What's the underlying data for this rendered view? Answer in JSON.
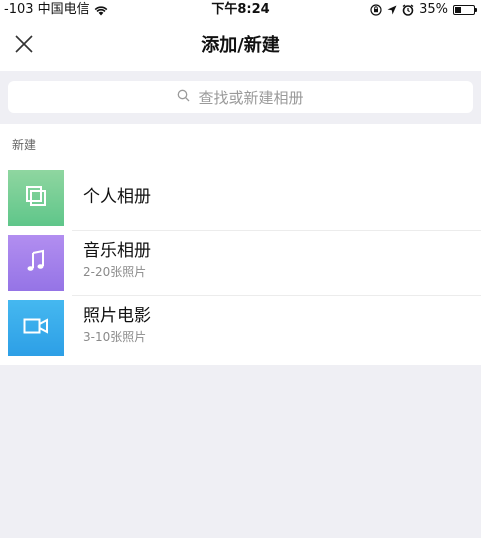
{
  "status_bar": {
    "carrier": "-103 中国电信",
    "time": "下午8:24",
    "battery": "35%",
    "battery_level": 0.35
  },
  "nav": {
    "title": "添加/新建"
  },
  "search": {
    "placeholder": "查找或新建相册"
  },
  "section": {
    "header": "新建"
  },
  "items": [
    {
      "title": "个人相册",
      "subtitle": "",
      "icon": "album-icon",
      "color": "#6fcd93"
    },
    {
      "title": "音乐相册",
      "subtitle": "2-20张照片",
      "icon": "music-note-icon",
      "color": "#a482eb"
    },
    {
      "title": "照片电影",
      "subtitle": "3-10张照片",
      "icon": "video-camera-icon",
      "color": "#37acec"
    }
  ]
}
